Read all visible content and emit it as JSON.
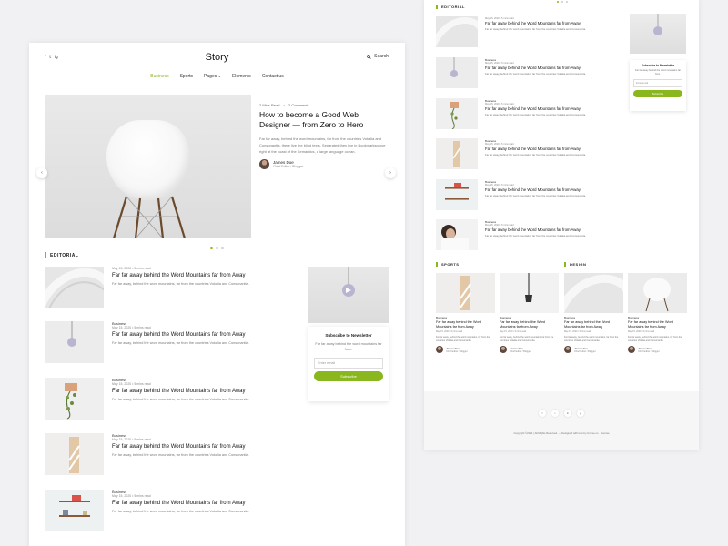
{
  "left_page": {
    "social_icons": [
      "f",
      "t",
      "ig"
    ],
    "logo": "Story",
    "search_label": "Search",
    "nav": [
      {
        "label": "Business",
        "active": true
      },
      {
        "label": "Sports",
        "active": false
      },
      {
        "label": "Pages",
        "active": false
      },
      {
        "label": "Elements",
        "active": false
      },
      {
        "label": "Contact us",
        "active": false
      }
    ],
    "hero": {
      "read_time": "2 Mins Read",
      "comments": "2 Comments",
      "title": "How to become a Good Web Designer — from Zero to Hero",
      "desc": "Far far away, behind the word mountains, far from the countries Vokalia and Consonantia, there live the blind texts. Separated they live in Bookmarksgrove right at the coast of the Semantics, a large language ocean.",
      "author_name": "James Doe",
      "author_role": "Chief Editor / Blogger",
      "prev": "‹",
      "next": "›"
    },
    "section_editorial": "EDITORIAL",
    "posts": [
      {
        "cat": "",
        "date": "May 15, 2020 • 5 mins read",
        "title": "Far far away behind the Word Mountains far from Away",
        "excerpt": "Far far away, behind the word mountains, far from the countries Vokalia and Consonantia."
      },
      {
        "cat": "Business",
        "date": "May 15, 2020 • 5 mins read",
        "title": "Far far away behind the Word Mountains far from Away",
        "excerpt": "Far far away, behind the word mountains, far from the countries Vokalia and Consonantia."
      },
      {
        "cat": "Business",
        "date": "May 15, 2020 • 5 mins read",
        "title": "Far far away behind the Word Mountains far from Away",
        "excerpt": "Far far away, behind the word mountains, far from the countries Vokalia and Consonantia."
      },
      {
        "cat": "Business",
        "date": "May 15, 2020 • 5 mins read",
        "title": "Far far away behind the Word Mountains far from Away",
        "excerpt": "Far far away, behind the word mountains, far from the countries Vokalia and Consonantia."
      },
      {
        "cat": "Business",
        "date": "May 15, 2020 • 5 mins read",
        "title": "Far far away behind the Word Mountains far from Away",
        "excerpt": "Far far away, behind the word mountains, far from the countries Vokalia and Consonantia."
      }
    ],
    "newsletter": {
      "title": "Subscribe to Newsletter",
      "desc": "Far far away behind the word mountains far from.",
      "placeholder": "Enter email",
      "button": "Subscribe"
    }
  },
  "right_page": {
    "section_editorial": "EDITORIAL",
    "posts": [
      {
        "cat": "",
        "date": "May 15, 2020 • 5 mins read",
        "title": "Far far away behind the Word Mountains far from Away",
        "excerpt": "Far far away, behind the word mountains, far from the countries Vokalia and Consonantia."
      },
      {
        "cat": "Business",
        "date": "May 15, 2020 • 5 mins read",
        "title": "Far far away behind the Word Mountains far from Away",
        "excerpt": "Far far away, behind the word mountains, far from the countries Vokalia and Consonantia."
      },
      {
        "cat": "Business",
        "date": "May 15, 2020 • 5 mins read",
        "title": "Far far away behind the Word Mountains far from Away",
        "excerpt": "Far far away, behind the word mountains, far from the countries Vokalia and Consonantia."
      },
      {
        "cat": "Business",
        "date": "May 15, 2020 • 5 mins read",
        "title": "Far far away behind the Word Mountains far from Away",
        "excerpt": "Far far away, behind the word mountains, far from the countries Vokalia and Consonantia."
      },
      {
        "cat": "Business",
        "date": "May 15, 2020 • 5 mins read",
        "title": "Far far away behind the Word Mountains far from Away",
        "excerpt": "Far far away, behind the word mountains, far from the countries Vokalia and Consonantia."
      },
      {
        "cat": "Business",
        "date": "May 15, 2020 • 5 mins read",
        "title": "Far far away behind the Word Mountains far from Away",
        "excerpt": "Far far away, behind the word mountains, far from the countries Vokalia and Consonantia."
      }
    ],
    "newsletter": {
      "title": "Subscribe to Newsletter",
      "desc": "Far far away behind the word mountains far from.",
      "placeholder": "Enter email",
      "button": "Subscribe"
    },
    "section_sports": "SPORTS",
    "section_design": "DESIGN",
    "cards": [
      {
        "cat": "Business",
        "title": "Far far away behind the Word Mountains far from Away",
        "date": "May 15, 2020 • 5 mins read",
        "excerpt": "Far far away, behind the word mountains, far from the countries Vokalia and Consonantia.",
        "author": "James Doe",
        "role": "Chief Editor / Blogger"
      },
      {
        "cat": "Business",
        "title": "Far far away behind the Word Mountains far from Away",
        "date": "May 15, 2020 • 5 mins read",
        "excerpt": "Far far away, behind the word mountains, far from the countries Vokalia and Consonantia.",
        "author": "James Doe",
        "role": "Chief Editor / Blogger"
      },
      {
        "cat": "Business",
        "title": "Far far away behind the Word Mountains far from Away",
        "date": "May 15, 2020 • 5 mins read",
        "excerpt": "Far far away, behind the word mountains, far from the countries Vokalia and Consonantia.",
        "author": "James Doe",
        "role": "Chief Editor / Blogger"
      },
      {
        "cat": "Business",
        "title": "Far far away behind the Word Mountains far from Away",
        "date": "May 15, 2020 • 5 mins read",
        "excerpt": "Far far away, behind the word mountains, far from the countries Vokalia and Consonantia.",
        "author": "James Doe",
        "role": "Chief Editor / Blogger"
      }
    ],
    "footer": {
      "social_icons": [
        "f",
        "t",
        "in",
        "yt"
      ],
      "copyright": "Copyright ©2021 | All Rights Reserved. — Designed with love by Untree.co · License"
    }
  },
  "colors": {
    "accent": "#8ab61e",
    "bg": "#f1f1f3"
  }
}
